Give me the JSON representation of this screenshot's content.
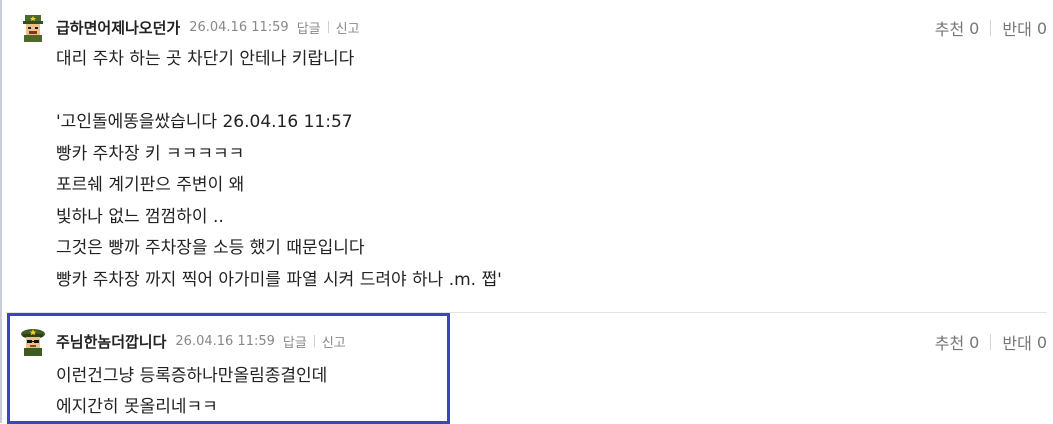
{
  "comments": [
    {
      "author": "급하면어제나오던가",
      "date": "26.04.16 11:59",
      "reply_label": "답글",
      "report_label": "신고",
      "upvote_label": "추천",
      "upvote_count": "0",
      "downvote_label": "반대",
      "downvote_count": "0",
      "avatar_icon": "soldier-rank-avatar-icon",
      "lines": [
        "대리 주차 하는 곳 차단기 안테나 키랍니다",
        "",
        "'고인돌에똥을쌌습니다 26.04.16 11:57",
        "빵카 주차장 키 ㅋㅋㅋㅋㅋ",
        "포르쉐 계기판으 주변이 왜",
        "빛하나 없느 껌껌하이 ..",
        "그것은 빵까 주차장을 소등 했기 때문입니다",
        "빵카 주차장 까지 찍어 아가미를 파열 시켜 드려야 하나 .m. 쩝'"
      ]
    },
    {
      "author": "주님한놈더깝니다",
      "date": "26.04.16 11:59",
      "reply_label": "답글",
      "report_label": "신고",
      "upvote_label": "추천",
      "upvote_count": "0",
      "downvote_label": "반대",
      "downvote_count": "0",
      "avatar_icon": "officer-rank-avatar-icon",
      "lines": [
        "이런건그냥 등록증하나만올림종결인데",
        "에지간히 못올리네ㅋㅋ"
      ]
    }
  ],
  "colors": {
    "highlight_border": "#3a44c4",
    "meta_text": "#888888"
  }
}
